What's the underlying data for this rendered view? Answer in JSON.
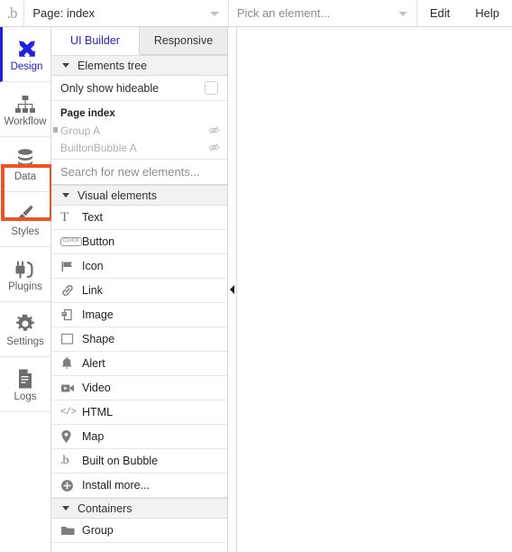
{
  "toolbar": {
    "logo": ".b",
    "page_select": {
      "label": "Page: index",
      "icon": "chevron-down-icon"
    },
    "element_select": {
      "placeholder": "Pick an element...",
      "icon": "chevron-down-icon"
    },
    "menus": [
      {
        "label": "Edit"
      },
      {
        "label": "Help"
      }
    ]
  },
  "rail": {
    "items": [
      {
        "label": "Design",
        "icon": "design-tools-icon",
        "active": true,
        "highlighted": false
      },
      {
        "label": "Workflow",
        "icon": "workflow-icon",
        "active": false,
        "highlighted": false
      },
      {
        "label": "Data",
        "icon": "database-icon",
        "active": false,
        "highlighted": true
      },
      {
        "label": "Styles",
        "icon": "paintbrush-icon",
        "active": false,
        "highlighted": false
      },
      {
        "label": "Plugins",
        "icon": "plug-icon",
        "active": false,
        "highlighted": false
      },
      {
        "label": "Settings",
        "icon": "gear-icon",
        "active": false,
        "highlighted": false
      },
      {
        "label": "Logs",
        "icon": "document-lines-icon",
        "active": false,
        "highlighted": false
      }
    ],
    "highlight_color": "#f4511e",
    "active_color": "#2222dd"
  },
  "panel": {
    "tabs": [
      {
        "label": "UI Builder",
        "active": true
      },
      {
        "label": "Responsive",
        "active": false
      }
    ],
    "elements_tree": {
      "title": "Elements tree",
      "only_show_hideable": {
        "label": "Only show hideable",
        "checked": false
      },
      "nodes": [
        {
          "label": "Page index",
          "level": 0,
          "hidden_icon": false,
          "muted": false,
          "selected_marker": false
        },
        {
          "label": "Group A",
          "level": 1,
          "hidden_icon": true,
          "muted": true,
          "selected_marker": true
        },
        {
          "label": "BuiltonBubble A",
          "level": 1,
          "hidden_icon": true,
          "muted": true,
          "selected_marker": false
        }
      ],
      "search_placeholder": "Search for new elements..."
    },
    "visual_elements": {
      "title": "Visual elements",
      "items": [
        {
          "label": "Text",
          "icon": "serif-t-icon"
        },
        {
          "label": "Button",
          "icon": "click-button-icon"
        },
        {
          "label": "Icon",
          "icon": "flag-icon"
        },
        {
          "label": "Link",
          "icon": "chain-link-icon"
        },
        {
          "label": "Image",
          "icon": "image-icon"
        },
        {
          "label": "Shape",
          "icon": "square-icon"
        },
        {
          "label": "Alert",
          "icon": "bell-icon"
        },
        {
          "label": "Video",
          "icon": "video-camera-icon"
        },
        {
          "label": "HTML",
          "icon": "code-brackets-icon"
        },
        {
          "label": "Map",
          "icon": "map-pin-icon"
        },
        {
          "label": "Built on Bubble",
          "icon": "bubble-logo-icon"
        },
        {
          "label": "Install more...",
          "icon": "plus-circle-icon"
        }
      ]
    },
    "containers": {
      "title": "Containers",
      "items": [
        {
          "label": "Group",
          "icon": "folder-icon"
        }
      ]
    }
  },
  "canvas": {
    "collapse_handle_icon": "triangle-left-icon"
  }
}
